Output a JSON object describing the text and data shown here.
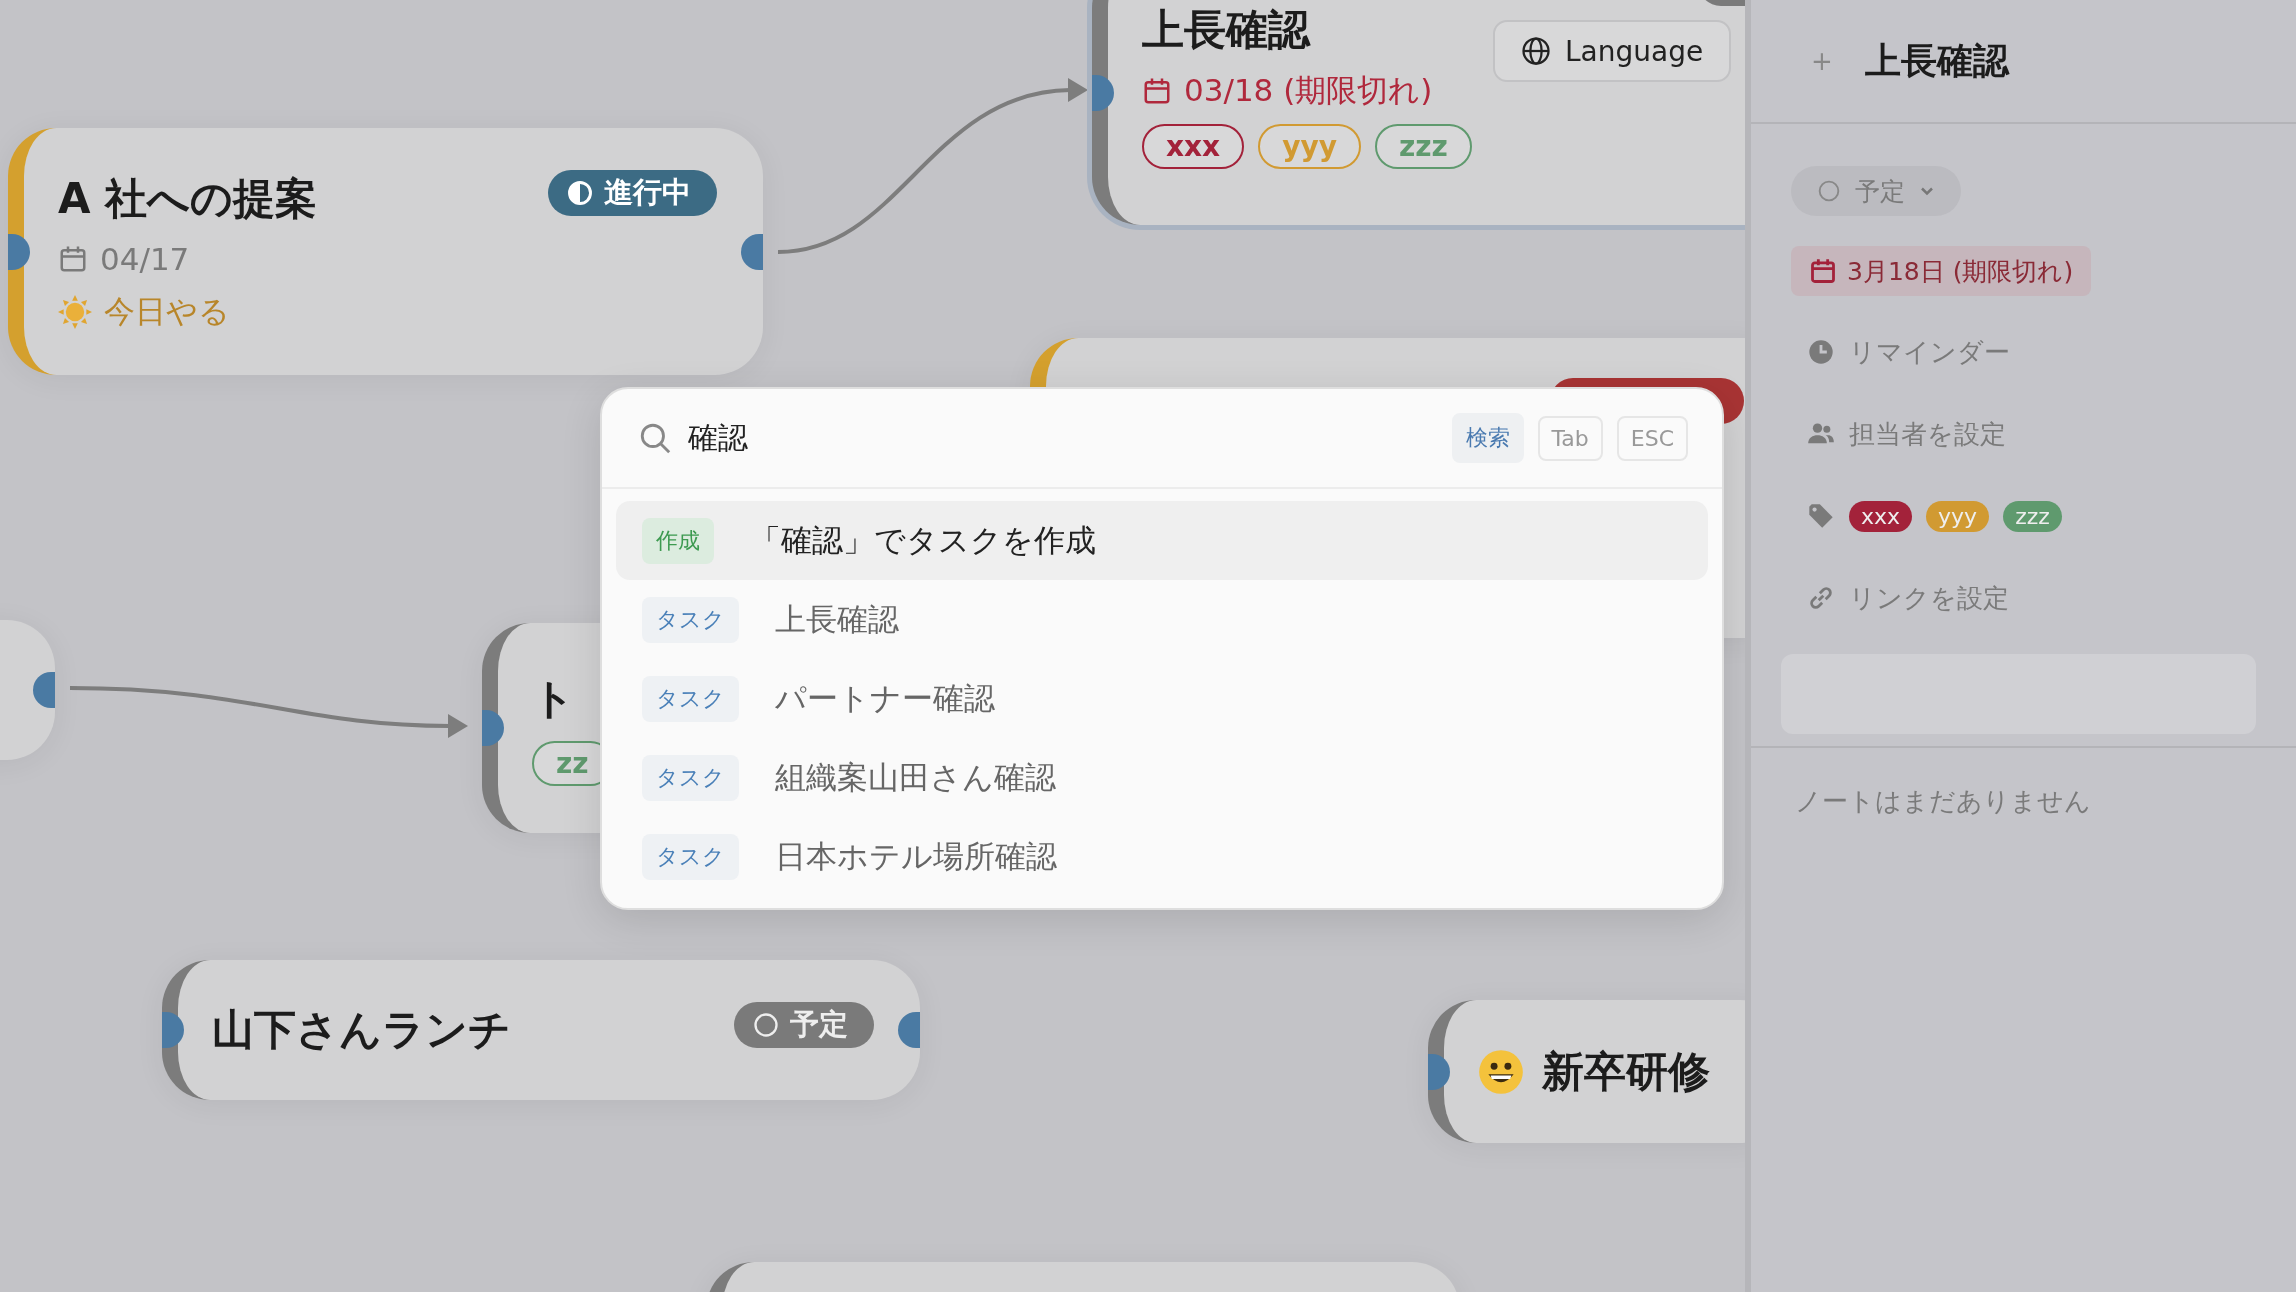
{
  "canvas": {
    "language_button": {
      "label": "Language"
    },
    "nodes": [
      {
        "title": "A 社への提案",
        "color": "#d4a02e",
        "status": {
          "kind": "in_progress",
          "label": "進行中"
        },
        "date": {
          "text": "04/17",
          "overdue": false
        },
        "today": "今日やる",
        "selected": false
      },
      {
        "title": "上長確認",
        "color": "#7c7c7c",
        "status": {
          "kind": "planned"
        },
        "date": {
          "text": "03/18 (期限切れ)",
          "overdue": true
        },
        "tags": [
          {
            "label": "xxx",
            "color": "#a3223a"
          },
          {
            "label": "yyy",
            "color": "#d19a32"
          },
          {
            "label": "zzz",
            "color": "#5f9a6e"
          }
        ],
        "selected": true
      },
      {
        "color": "#d4a02e",
        "status": {
          "kind": "overdue"
        },
        "selected": false
      },
      {
        "selected": false
      },
      {
        "title": "ト",
        "color": "#7c7c7c",
        "tags": [
          {
            "label": "zz",
            "color": "#5f9a6e"
          }
        ],
        "selected": false
      },
      {
        "title": "山下さんランチ",
        "color": "#7c7c7c",
        "status": {
          "kind": "planned",
          "label": "予定"
        },
        "selected": false
      },
      {
        "title": "新卒研修",
        "emoji": true,
        "color": "#7c7c7c",
        "selected": false
      },
      {
        "color": "#7c7c7c",
        "selected": false
      }
    ]
  },
  "palette": {
    "search": {
      "value": "確認",
      "chips": [
        {
          "label": "検索",
          "kind": "filled"
        },
        {
          "label": "Tab",
          "kind": "outline"
        },
        {
          "label": "ESC",
          "kind": "outline"
        }
      ]
    },
    "results": [
      {
        "badge": {
          "kind": "create",
          "label": "作成"
        },
        "text": "「確認」でタスクを作成",
        "selected": true
      },
      {
        "badge": {
          "kind": "task",
          "label": "タスク"
        },
        "text": "上長確認",
        "selected": false
      },
      {
        "badge": {
          "kind": "task",
          "label": "タスク"
        },
        "text": "パートナー確認",
        "selected": false
      },
      {
        "badge": {
          "kind": "task",
          "label": "タスク"
        },
        "text": "組織案山田さん確認",
        "selected": false
      },
      {
        "badge": {
          "kind": "task",
          "label": "タスク"
        },
        "text": "日本ホテル場所確認",
        "selected": false
      }
    ]
  },
  "panel": {
    "add": "+",
    "title": "上長確認",
    "status": {
      "label": "予定"
    },
    "due": {
      "text": "3月18日 (期限切れ)",
      "overdue": true
    },
    "fields": [
      {
        "kind": "reminder",
        "label": "リマインダー"
      },
      {
        "kind": "assignee",
        "label": "担当者を設定"
      },
      {
        "kind": "tags",
        "tags": [
          {
            "label": "xxx",
            "color": "#a3223a"
          },
          {
            "label": "yyy",
            "color": "#d19a32"
          },
          {
            "label": "zzz",
            "color": "#5f9a6e"
          }
        ]
      },
      {
        "kind": "link",
        "label": "リンクを設定"
      }
    ],
    "notes_empty": "ノートはまだありません"
  }
}
